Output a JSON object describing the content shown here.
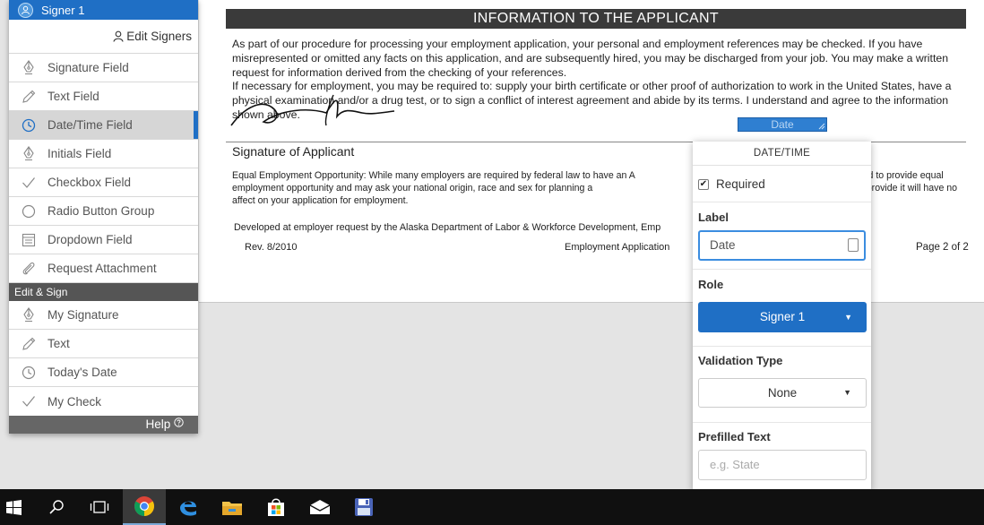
{
  "sidebar": {
    "signer": "Signer 1",
    "edit_signers": "Edit Signers",
    "fields": [
      {
        "label": "Signature Field",
        "icon": "pen-nib-icon"
      },
      {
        "label": "Text Field",
        "icon": "pencil-icon"
      },
      {
        "label": "Date/Time Field",
        "icon": "clock-icon",
        "active": true
      },
      {
        "label": "Initials Field",
        "icon": "pen-nib-icon"
      },
      {
        "label": "Checkbox Field",
        "icon": "checkmark-icon"
      },
      {
        "label": "Radio Button Group",
        "icon": "radio-icon"
      },
      {
        "label": "Dropdown Field",
        "icon": "dropdown-list-icon"
      },
      {
        "label": "Request Attachment",
        "icon": "paperclip-icon"
      }
    ],
    "section": "Edit & Sign",
    "edit_items": [
      {
        "label": "My Signature",
        "icon": "pen-nib-icon"
      },
      {
        "label": "Text",
        "icon": "pencil-icon"
      },
      {
        "label": "Today's Date",
        "icon": "clock-icon"
      },
      {
        "label": "My Check",
        "icon": "checkmark-icon"
      }
    ],
    "help": "Help"
  },
  "document": {
    "header": "INFORMATION TO THE APPLICANT",
    "para1": "As part of our procedure for processing your employment application, your personal and employment references may be checked. If you have misrepresented or omitted any facts on this application, and are subsequently hired, you may be discharged from your job. You may make a written request for information derived from the checking of your references.",
    "para2": "If necessary for employment, you may be required to: supply your birth certificate or other proof of authorization to work in the United States, have a physical examination and/or a drug test, or to sign a conflict of interest agreement and abide by its terms. I understand and agree to the information shown above.",
    "date_field": "Date",
    "signature_title": "Signature of Applicant",
    "eeo": "Equal Employment Opportunity: While many employers are required by federal law to have an A                                                                   rs are required to provide equal employment opportunity and may ask your national origin, race and sex for planning a                                                     mation is optional and failure to provide it will have no affect on your application for employment.",
    "developed": "Developed at employer request by the Alaska Department of Labor & Workforce Development, Emp",
    "rev": "Rev. 8/2010",
    "form_name": "Employment Application",
    "page": "Page 2 of 2"
  },
  "popover": {
    "title": "DATE/TIME",
    "required_label": "Required",
    "required_checked": true,
    "label_heading": "Label",
    "label_value": "Date",
    "role_heading": "Role",
    "role_value": "Signer 1",
    "validation_heading": "Validation Type",
    "validation_value": "None",
    "prefilled_heading": "Prefilled Text",
    "prefilled_placeholder": "e.g. State"
  },
  "taskbar": {
    "items": [
      "windows-start-icon",
      "search-icon",
      "task-view-icon",
      "chrome-icon",
      "edge-icon",
      "file-explorer-icon",
      "store-icon",
      "mail-icon",
      "save-app-icon"
    ]
  },
  "colors": {
    "accent": "#1f6fc5",
    "header_bg": "#3a3a3a",
    "section_bg": "#555555"
  }
}
